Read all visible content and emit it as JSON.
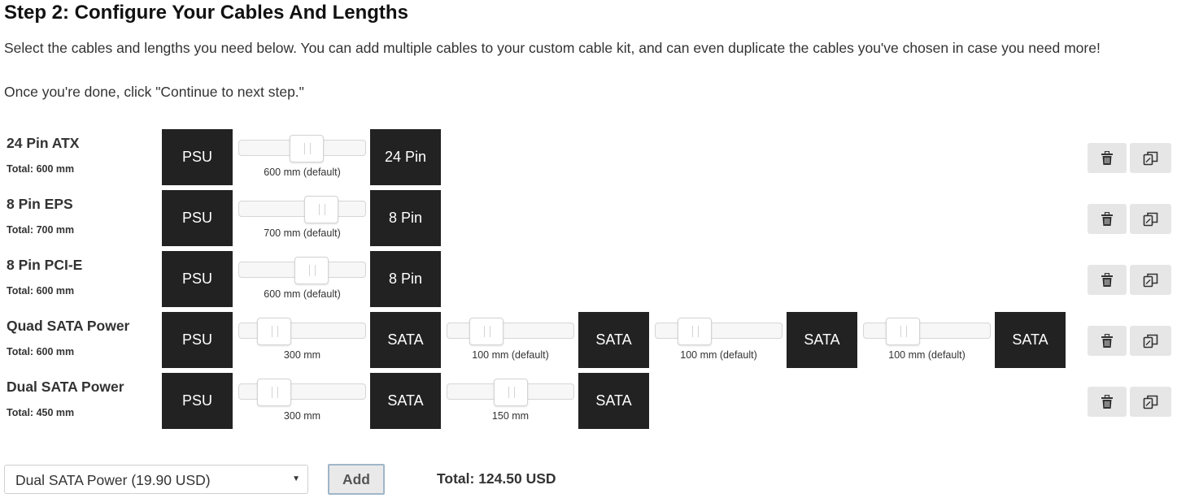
{
  "heading": "Step 2: Configure Your Cables And Lengths",
  "intro": "Select the cables and lengths you need below. You can add multiple cables to your custom cable kit, and can even duplicate the cables you've chosen in case you need more!",
  "instruction": "Once you're done, click \"Continue to next step.\"",
  "cables": [
    {
      "name": "24 Pin ATX",
      "total": "Total: 600 mm",
      "connectors": [
        "PSU",
        "24 Pin"
      ],
      "sliders": [
        {
          "label": "600 mm (default)",
          "value_mm": 600,
          "level": 0.55
        }
      ]
    },
    {
      "name": "8 Pin EPS",
      "total": "Total: 700 mm",
      "connectors": [
        "PSU",
        "8 Pin"
      ],
      "sliders": [
        {
          "label": "700 mm (default)",
          "value_mm": 700,
          "level": 0.7
        }
      ]
    },
    {
      "name": "8 Pin PCI-E",
      "total": "Total: 600 mm",
      "connectors": [
        "PSU",
        "8 Pin"
      ],
      "sliders": [
        {
          "label": "600 mm (default)",
          "value_mm": 600,
          "level": 0.6
        }
      ]
    },
    {
      "name": "Quad SATA Power",
      "total": "Total: 600 mm",
      "connectors": [
        "PSU",
        "SATA",
        "SATA",
        "SATA",
        "SATA"
      ],
      "sliders": [
        {
          "label": "300 mm",
          "value_mm": 300,
          "level": 0.2
        },
        {
          "label": "100 mm (default)",
          "value_mm": 100,
          "level": 0.24
        },
        {
          "label": "100 mm (default)",
          "value_mm": 100,
          "level": 0.24
        },
        {
          "label": "100 mm (default)",
          "value_mm": 100,
          "level": 0.24
        }
      ]
    },
    {
      "name": "Dual SATA Power",
      "total": "Total: 450 mm",
      "connectors": [
        "PSU",
        "SATA",
        "SATA"
      ],
      "sliders": [
        {
          "label": "300 mm",
          "value_mm": 300,
          "level": 0.2
        },
        {
          "label": "150 mm",
          "value_mm": 150,
          "level": 0.5
        }
      ]
    }
  ],
  "actions": {
    "delete_icon": "trash-icon",
    "duplicate_icon": "copy-icon"
  },
  "add_form": {
    "selected_option": "Dual SATA Power (19.90 USD)",
    "add_label": "Add"
  },
  "grand_total": "Total: 124.50 USD",
  "colors": {
    "connector_bg": "#222222",
    "connector_text": "#ffffff",
    "action_button_bg": "#e6e6e6",
    "add_button_border": "#9fb6c9"
  }
}
